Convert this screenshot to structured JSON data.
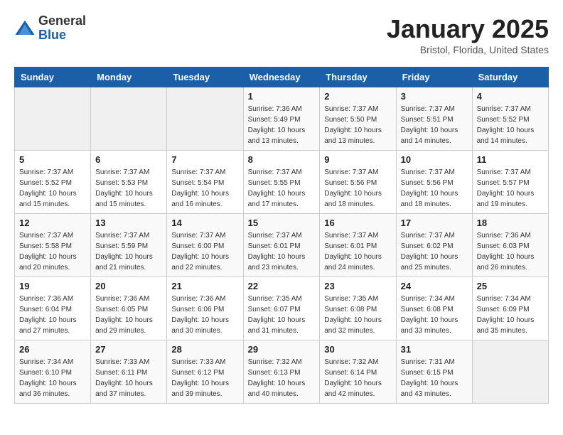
{
  "header": {
    "logo_general": "General",
    "logo_blue": "Blue",
    "month_title": "January 2025",
    "location": "Bristol, Florida, United States"
  },
  "weekdays": [
    "Sunday",
    "Monday",
    "Tuesday",
    "Wednesday",
    "Thursday",
    "Friday",
    "Saturday"
  ],
  "weeks": [
    [
      {
        "day": "",
        "info": ""
      },
      {
        "day": "",
        "info": ""
      },
      {
        "day": "",
        "info": ""
      },
      {
        "day": "1",
        "info": "Sunrise: 7:36 AM\nSunset: 5:49 PM\nDaylight: 10 hours\nand 13 minutes."
      },
      {
        "day": "2",
        "info": "Sunrise: 7:37 AM\nSunset: 5:50 PM\nDaylight: 10 hours\nand 13 minutes."
      },
      {
        "day": "3",
        "info": "Sunrise: 7:37 AM\nSunset: 5:51 PM\nDaylight: 10 hours\nand 14 minutes."
      },
      {
        "day": "4",
        "info": "Sunrise: 7:37 AM\nSunset: 5:52 PM\nDaylight: 10 hours\nand 14 minutes."
      }
    ],
    [
      {
        "day": "5",
        "info": "Sunrise: 7:37 AM\nSunset: 5:52 PM\nDaylight: 10 hours\nand 15 minutes."
      },
      {
        "day": "6",
        "info": "Sunrise: 7:37 AM\nSunset: 5:53 PM\nDaylight: 10 hours\nand 15 minutes."
      },
      {
        "day": "7",
        "info": "Sunrise: 7:37 AM\nSunset: 5:54 PM\nDaylight: 10 hours\nand 16 minutes."
      },
      {
        "day": "8",
        "info": "Sunrise: 7:37 AM\nSunset: 5:55 PM\nDaylight: 10 hours\nand 17 minutes."
      },
      {
        "day": "9",
        "info": "Sunrise: 7:37 AM\nSunset: 5:56 PM\nDaylight: 10 hours\nand 18 minutes."
      },
      {
        "day": "10",
        "info": "Sunrise: 7:37 AM\nSunset: 5:56 PM\nDaylight: 10 hours\nand 18 minutes."
      },
      {
        "day": "11",
        "info": "Sunrise: 7:37 AM\nSunset: 5:57 PM\nDaylight: 10 hours\nand 19 minutes."
      }
    ],
    [
      {
        "day": "12",
        "info": "Sunrise: 7:37 AM\nSunset: 5:58 PM\nDaylight: 10 hours\nand 20 minutes."
      },
      {
        "day": "13",
        "info": "Sunrise: 7:37 AM\nSunset: 5:59 PM\nDaylight: 10 hours\nand 21 minutes."
      },
      {
        "day": "14",
        "info": "Sunrise: 7:37 AM\nSunset: 6:00 PM\nDaylight: 10 hours\nand 22 minutes."
      },
      {
        "day": "15",
        "info": "Sunrise: 7:37 AM\nSunset: 6:01 PM\nDaylight: 10 hours\nand 23 minutes."
      },
      {
        "day": "16",
        "info": "Sunrise: 7:37 AM\nSunset: 6:01 PM\nDaylight: 10 hours\nand 24 minutes."
      },
      {
        "day": "17",
        "info": "Sunrise: 7:37 AM\nSunset: 6:02 PM\nDaylight: 10 hours\nand 25 minutes."
      },
      {
        "day": "18",
        "info": "Sunrise: 7:36 AM\nSunset: 6:03 PM\nDaylight: 10 hours\nand 26 minutes."
      }
    ],
    [
      {
        "day": "19",
        "info": "Sunrise: 7:36 AM\nSunset: 6:04 PM\nDaylight: 10 hours\nand 27 minutes."
      },
      {
        "day": "20",
        "info": "Sunrise: 7:36 AM\nSunset: 6:05 PM\nDaylight: 10 hours\nand 29 minutes."
      },
      {
        "day": "21",
        "info": "Sunrise: 7:36 AM\nSunset: 6:06 PM\nDaylight: 10 hours\nand 30 minutes."
      },
      {
        "day": "22",
        "info": "Sunrise: 7:35 AM\nSunset: 6:07 PM\nDaylight: 10 hours\nand 31 minutes."
      },
      {
        "day": "23",
        "info": "Sunrise: 7:35 AM\nSunset: 6:08 PM\nDaylight: 10 hours\nand 32 minutes."
      },
      {
        "day": "24",
        "info": "Sunrise: 7:34 AM\nSunset: 6:08 PM\nDaylight: 10 hours\nand 33 minutes."
      },
      {
        "day": "25",
        "info": "Sunrise: 7:34 AM\nSunset: 6:09 PM\nDaylight: 10 hours\nand 35 minutes."
      }
    ],
    [
      {
        "day": "26",
        "info": "Sunrise: 7:34 AM\nSunset: 6:10 PM\nDaylight: 10 hours\nand 36 minutes."
      },
      {
        "day": "27",
        "info": "Sunrise: 7:33 AM\nSunset: 6:11 PM\nDaylight: 10 hours\nand 37 minutes."
      },
      {
        "day": "28",
        "info": "Sunrise: 7:33 AM\nSunset: 6:12 PM\nDaylight: 10 hours\nand 39 minutes."
      },
      {
        "day": "29",
        "info": "Sunrise: 7:32 AM\nSunset: 6:13 PM\nDaylight: 10 hours\nand 40 minutes."
      },
      {
        "day": "30",
        "info": "Sunrise: 7:32 AM\nSunset: 6:14 PM\nDaylight: 10 hours\nand 42 minutes."
      },
      {
        "day": "31",
        "info": "Sunrise: 7:31 AM\nSunset: 6:15 PM\nDaylight: 10 hours\nand 43 minutes."
      },
      {
        "day": "",
        "info": ""
      }
    ]
  ]
}
